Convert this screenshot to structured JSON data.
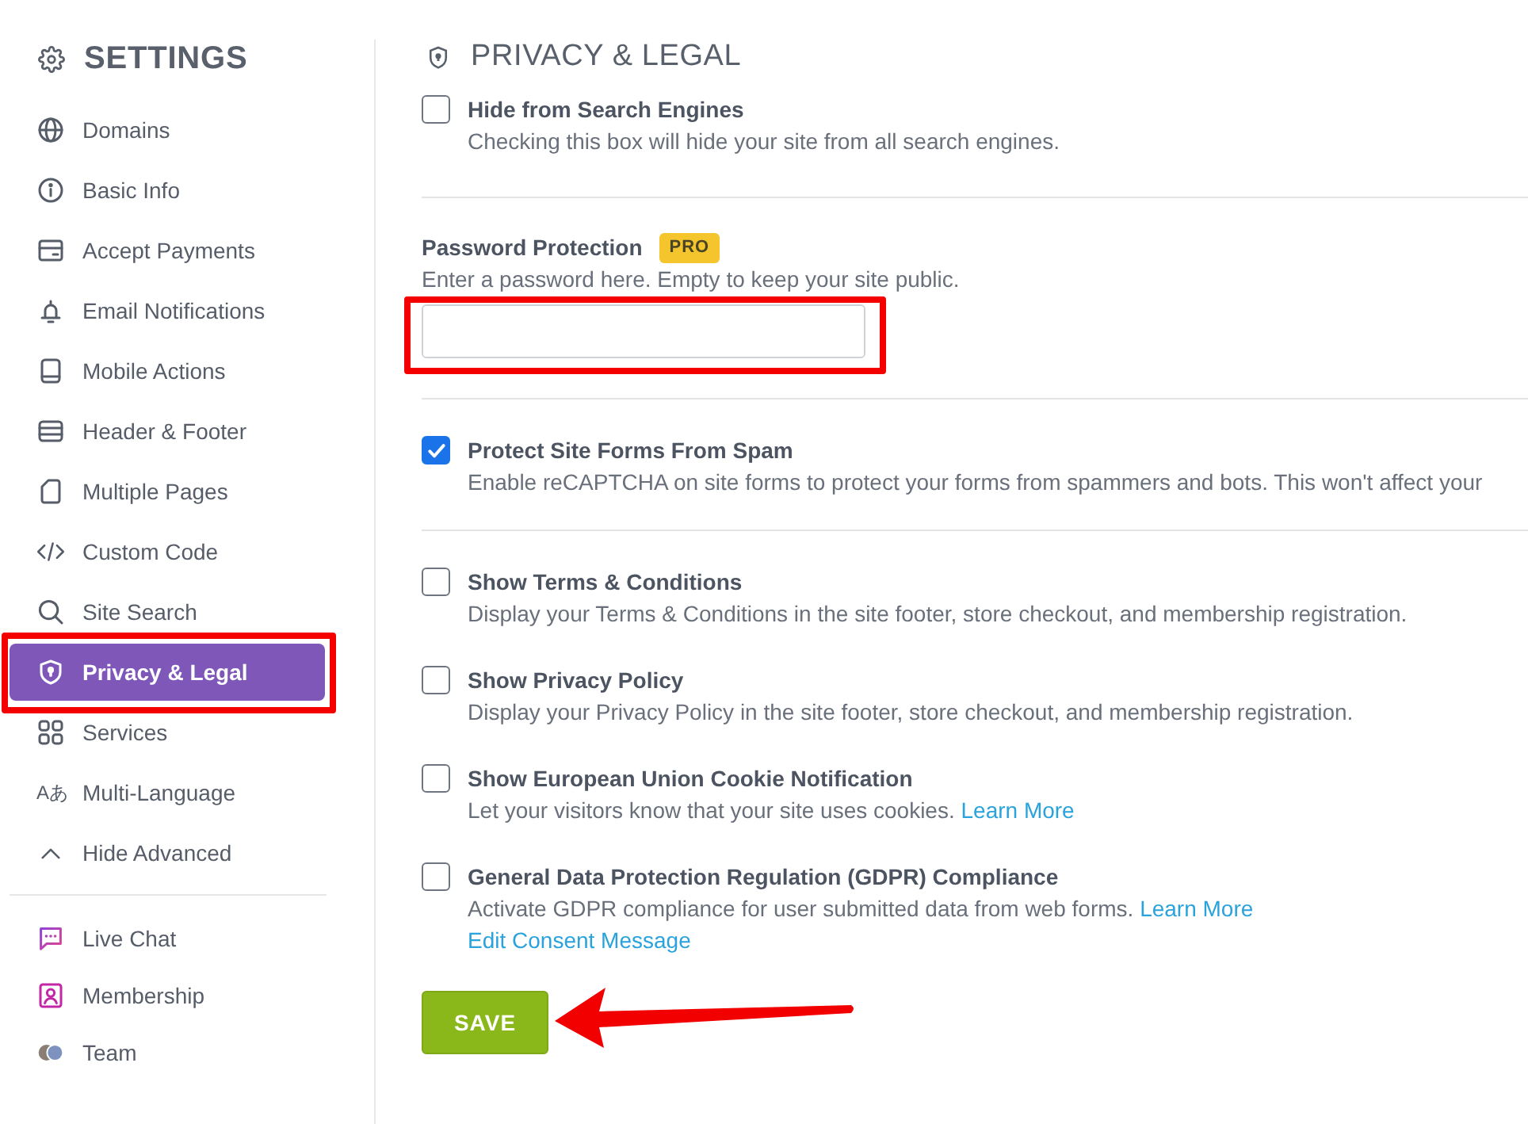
{
  "sidebar": {
    "title": "SETTINGS",
    "items": [
      {
        "label": "Domains",
        "selected": false,
        "framed": false
      },
      {
        "label": "Basic Info",
        "selected": false,
        "framed": false
      },
      {
        "label": "Accept Payments",
        "selected": false,
        "framed": false
      },
      {
        "label": "Email Notifications",
        "selected": false,
        "framed": false
      },
      {
        "label": "Mobile Actions",
        "selected": false,
        "framed": false
      },
      {
        "label": "Header & Footer",
        "selected": false,
        "framed": false
      },
      {
        "label": "Multiple Pages",
        "selected": false,
        "framed": false
      },
      {
        "label": "Custom Code",
        "selected": false,
        "framed": false
      },
      {
        "label": "Site Search",
        "selected": false,
        "framed": false
      },
      {
        "label": "Privacy & Legal",
        "selected": true,
        "framed": true
      },
      {
        "label": "Services",
        "selected": false,
        "framed": false
      },
      {
        "label": "Multi-Language",
        "glyph": "Aあ",
        "selected": false,
        "framed": false
      },
      {
        "label": "Hide Advanced",
        "selected": false,
        "framed": false
      }
    ],
    "apps": [
      {
        "label": "Live Chat",
        "selected": false
      },
      {
        "label": "Membership",
        "selected": false
      },
      {
        "label": "Team",
        "selected": false
      }
    ]
  },
  "content": {
    "title": "PRIVACY & LEGAL",
    "sections": [
      {
        "kind": "checkbox",
        "options": [
          {
            "title": "Hide from Search Engines",
            "description": "Checking this box will hide your site from all search engines.",
            "checked": false
          }
        ]
      },
      {
        "kind": "password",
        "label": "Password Protection",
        "badge": "PRO",
        "hint": "Enter a password here. Empty to keep your site public.",
        "framed": true
      },
      {
        "kind": "checkbox",
        "options": [
          {
            "title": "Protect Site Forms From Spam",
            "description": "Enable reCAPTCHA on site forms to protect your forms from spammers and bots. This won't affect your",
            "checked": true
          }
        ]
      },
      {
        "kind": "checkbox",
        "options": [
          {
            "title": "Show Terms & Conditions",
            "description": "Display your Terms & Conditions in the site footer, store checkout, and membership registration.",
            "checked": false
          },
          {
            "title": "Show Privacy Policy",
            "description": "Display your Privacy Policy in the site footer, store checkout, and membership registration.",
            "checked": false
          },
          {
            "title": "Show European Union Cookie Notification",
            "description": "Let your visitors know that your site uses cookies.",
            "link": "Learn More",
            "checked": false
          },
          {
            "title": "General Data Protection Regulation (GDPR) Compliance",
            "description": "Activate GDPR compliance for user submitted data from web forms.",
            "link": "Learn More",
            "extra_link": "Edit Consent Message",
            "checked": false
          }
        ]
      }
    ],
    "save": {
      "label": "SAVE",
      "arrow": true
    }
  }
}
